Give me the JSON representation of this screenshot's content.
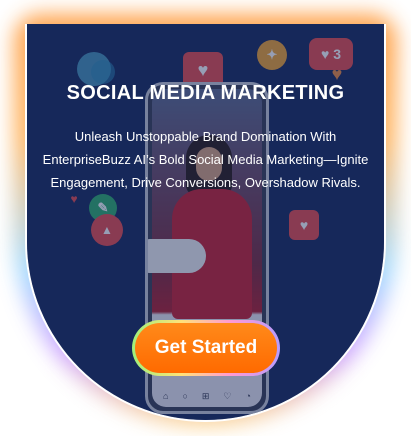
{
  "hero": {
    "title": "SOCIAL MEDIA MARKETING",
    "subtitle": "Unleash Unstoppable Brand Domination With EnterpriseBuzz AI’s Bold Social Media Marketing—Ignite Engagement, Drive Conversions, Overshadow Rivals.",
    "cta_label": "Get Started",
    "notification_count": "3"
  },
  "colors": {
    "background": "#16285a",
    "cta": "#ff7a00",
    "heart_red": "#e84b4b",
    "glow_orange": "#ff9a3c",
    "glow_blue": "#9ad7ff",
    "glow_purple": "#c99bff"
  },
  "icons": [
    "heart-icon",
    "chat-bubble-icon",
    "like-icon",
    "notification-icon",
    "triangle-icon",
    "megaphone-icon",
    "home-icon",
    "search-icon",
    "add-icon",
    "profile-icon"
  ]
}
